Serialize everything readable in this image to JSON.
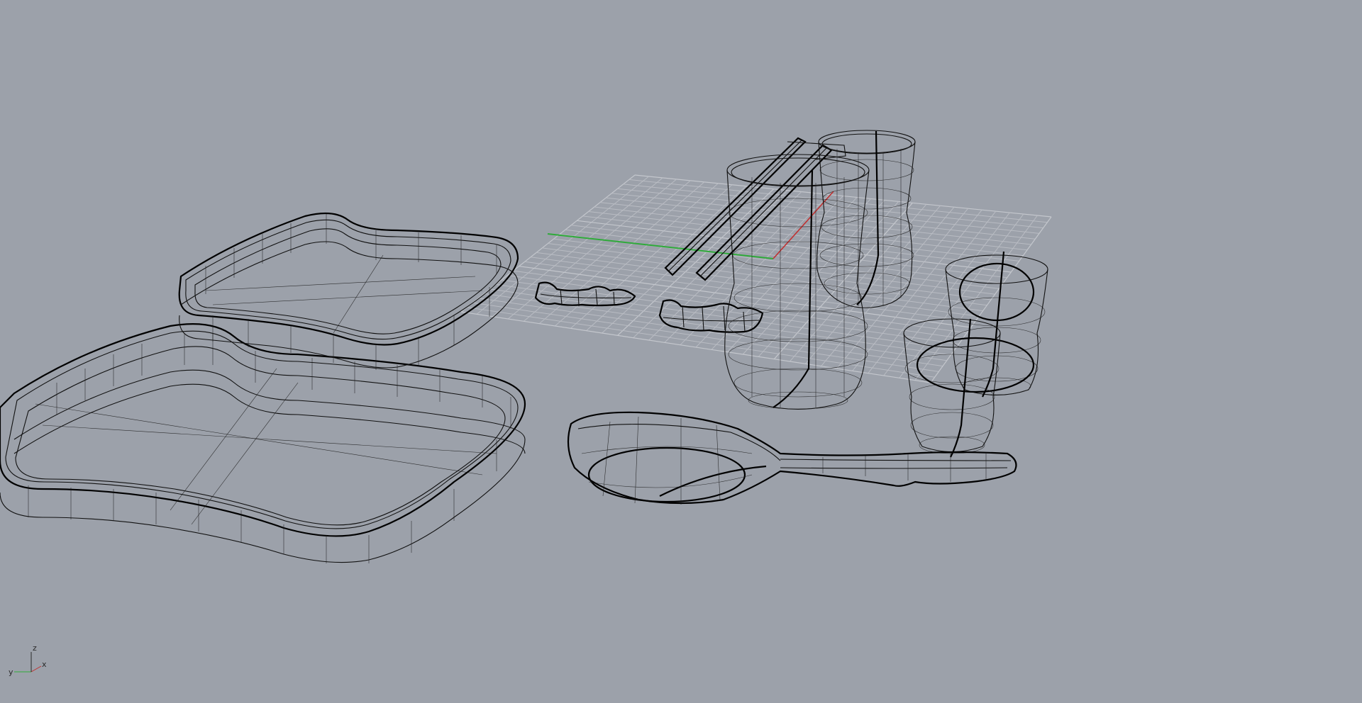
{
  "viewport": {
    "background": "#9ca1aa",
    "display_mode": "wireframe"
  },
  "axis_widget": {
    "x_label": "x",
    "y_label": "y",
    "z_label": "z",
    "x_color": "#c03030",
    "y_color": "#2faa3a"
  },
  "objects": [
    {
      "id": "tray-large",
      "kind": "rounded-tray"
    },
    {
      "id": "tray-small",
      "kind": "rounded-tray"
    },
    {
      "id": "chopstick-rest-1",
      "kind": "chopstick-rest"
    },
    {
      "id": "chopstick-rest-2",
      "kind": "chopstick-rest"
    },
    {
      "id": "chopsticks",
      "kind": "chopsticks"
    },
    {
      "id": "cup-tall-1",
      "kind": "cup"
    },
    {
      "id": "cup-tall-2",
      "kind": "cup"
    },
    {
      "id": "cup-small-1",
      "kind": "cup"
    },
    {
      "id": "cup-small-2",
      "kind": "cup"
    },
    {
      "id": "spoon",
      "kind": "spoon"
    }
  ]
}
